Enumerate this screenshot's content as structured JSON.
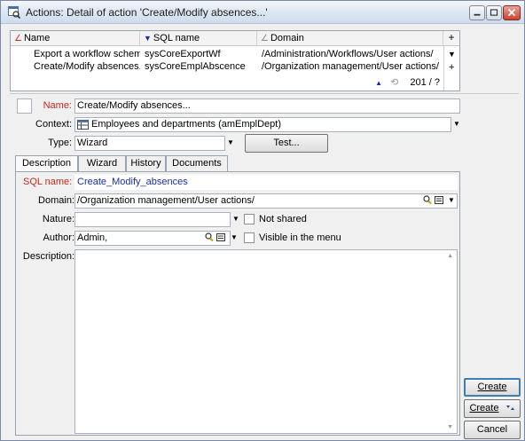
{
  "window": {
    "title": "Actions: Detail of action 'Create/Modify absences...'",
    "icon": "search-window-icon"
  },
  "list": {
    "columns": [
      "Name",
      "SQL name",
      "Domain"
    ],
    "rows": [
      [
        "Export a workflow scheme...",
        "sysCoreExportWf",
        "/Administration/Workflows/User actions/"
      ],
      [
        "Create/Modify absences...",
        "sysCoreEmplAbscence",
        "/Organization management/User actions/"
      ]
    ],
    "status": "201 / ?"
  },
  "form": {
    "name_label": "Name:",
    "name_value": "Create/Modify absences...",
    "context_label": "Context:",
    "context_value": "Employees and departments (amEmplDept)",
    "type_label": "Type:",
    "type_value": "Wizard",
    "test_button": "Test..."
  },
  "tabs": [
    "Description",
    "Wizard",
    "History",
    "Documents"
  ],
  "description_tab": {
    "sqlname_label": "SQL name:",
    "sqlname_value": "Create_Modify_absences",
    "domain_label": "Domain:",
    "domain_value": "/Organization management/User actions/",
    "nature_label": "Nature:",
    "nature_value": "",
    "not_shared_label": "Not shared",
    "author_label": "Author:",
    "author_value": "Admin,",
    "visible_menu_label": "Visible in the menu",
    "description_label": "Description:",
    "description_value": ""
  },
  "buttons": {
    "create": "Create",
    "create_alt": "Create",
    "cancel": "Cancel"
  },
  "colors": {
    "required_label": "#c8281e",
    "sql_value": "#1a2ea8",
    "default_button_border": "#3c7fb1"
  }
}
